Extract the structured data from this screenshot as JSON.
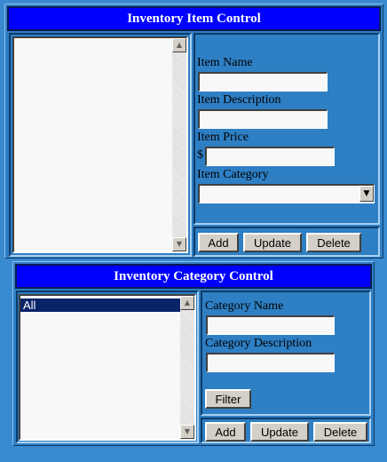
{
  "item_control": {
    "title": "Inventory Item Control",
    "labels": {
      "name": "Item Name",
      "description": "Item Description",
      "price": "Item Price",
      "currency": "$",
      "category": "Item Category"
    },
    "fields": {
      "name": "",
      "description": "",
      "price": "",
      "category": ""
    },
    "buttons": {
      "add": "Add",
      "update": "Update",
      "delete": "Delete"
    }
  },
  "category_control": {
    "title": "Inventory Category Control",
    "list_items": [
      "All"
    ],
    "selected_item": "All",
    "labels": {
      "name": "Category Name",
      "description": "Category Description"
    },
    "fields": {
      "name": "",
      "description": ""
    },
    "buttons": {
      "filter": "Filter",
      "add": "Add",
      "update": "Update",
      "delete": "Delete"
    }
  },
  "icons": {
    "scroll_up": "triangle-up-icon",
    "scroll_down": "triangle-down-icon",
    "dropdown": "chevron-down-icon"
  },
  "colors": {
    "background": "#3a8ad0",
    "header": "#0000ff",
    "selection": "#0a246a"
  }
}
